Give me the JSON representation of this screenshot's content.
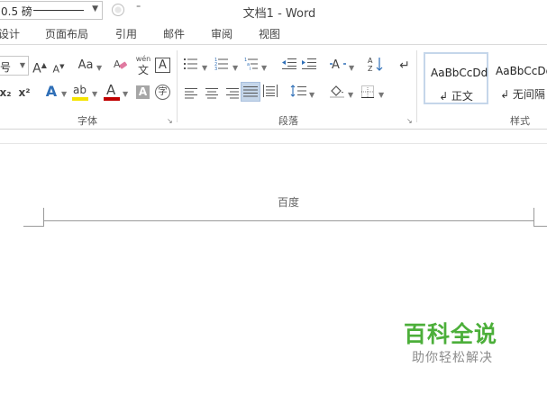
{
  "titlebar": {
    "pen_weight": "0.5 磅",
    "more_glyph": "⁼",
    "title": "文档1 - Word"
  },
  "tabs": [
    {
      "label": "设计"
    },
    {
      "label": "页面布局"
    },
    {
      "label": "引用"
    },
    {
      "label": "邮件"
    },
    {
      "label": "审阅"
    },
    {
      "label": "视图"
    }
  ],
  "font_group": {
    "size_value": "号",
    "grow": "A",
    "shrink": "A",
    "change_case": "Aa",
    "phonetic_top": "wén",
    "phonetic_bottom": "文",
    "border_char": "A",
    "subscript": "x₂",
    "superscript": "x²",
    "text_effect": "A",
    "highlight": "ab",
    "font_color": "A",
    "char_shading": "A",
    "enclose": "字",
    "label": "字体"
  },
  "paragraph_group": {
    "label": "段落",
    "sort_glyph": "A↓Z"
  },
  "styles_group": {
    "label": "样式",
    "cards": [
      {
        "sample": "AaBbCcDd",
        "name": "↲ 正文"
      },
      {
        "sample": "AaBbCcDd",
        "name": "↲ 无间隔"
      }
    ]
  },
  "document": {
    "header_text": "百度"
  },
  "watermark": {
    "title": "百科全说",
    "subtitle": "助你轻松解决"
  },
  "colors": {
    "highlight": "#f5e400",
    "font_red": "#c00000",
    "justify_active": "#c5d6ea",
    "watermark_green": "#4caf3a"
  }
}
